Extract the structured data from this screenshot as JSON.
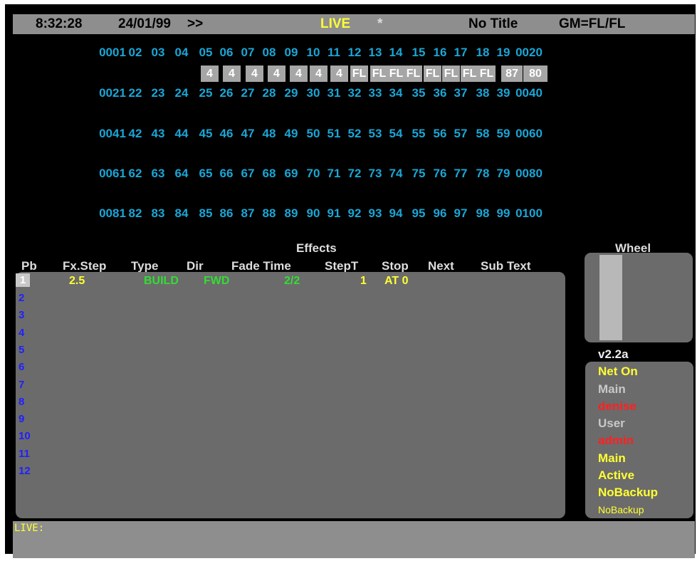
{
  "status": {
    "time": "8:32:28",
    "date": "24/01/99",
    "arrows": ">>",
    "mode": "LIVE",
    "star": "*",
    "title": "No Title",
    "gm": "GM=FL/FL"
  },
  "channels": {
    "row1": [
      "0001",
      "02",
      "03",
      "04",
      "05",
      "06",
      "07",
      "08",
      "09",
      "10",
      "11",
      "12",
      "13",
      "14",
      "15",
      "16",
      "17",
      "18",
      "19",
      "0020"
    ],
    "row2": [
      "0021",
      "22",
      "23",
      "24",
      "25",
      "26",
      "27",
      "28",
      "29",
      "30",
      "31",
      "32",
      "33",
      "34",
      "35",
      "36",
      "37",
      "38",
      "39",
      "0040"
    ],
    "row3": [
      "0041",
      "42",
      "43",
      "44",
      "45",
      "46",
      "47",
      "48",
      "49",
      "50",
      "51",
      "52",
      "53",
      "54",
      "55",
      "56",
      "57",
      "58",
      "59",
      "0060"
    ],
    "row4": [
      "0061",
      "62",
      "63",
      "64",
      "65",
      "66",
      "67",
      "68",
      "69",
      "70",
      "71",
      "72",
      "73",
      "74",
      "75",
      "76",
      "77",
      "78",
      "79",
      "0080"
    ],
    "row5": [
      "0081",
      "82",
      "83",
      "84",
      "85",
      "86",
      "87",
      "88",
      "89",
      "90",
      "91",
      "92",
      "93",
      "94",
      "95",
      "96",
      "97",
      "98",
      "99",
      "0100"
    ],
    "levels": [
      "4",
      "4",
      "4",
      "4",
      "4",
      "4",
      "4",
      "FL",
      "FL",
      "FL",
      "FL",
      "FL",
      "FL",
      "FL",
      "FL",
      "87",
      "80"
    ]
  },
  "effects": {
    "title": "Effects",
    "headers": [
      "Pb",
      "Fx.Step",
      "Type",
      "Dir",
      "Fade Time",
      "StepT",
      "Stop",
      "Next",
      "Sub Text"
    ],
    "row1": {
      "pb": "1",
      "fxstep": "2.5",
      "type": "BUILD",
      "dir": "FWD",
      "fade": "2/2",
      "stept": "1",
      "stop": "AT 0"
    },
    "playbacks": [
      "2",
      "3",
      "4",
      "5",
      "6",
      "7",
      "8",
      "9",
      "10",
      "11",
      "12"
    ]
  },
  "wheel": {
    "title": "Wheel",
    "level": 1.0
  },
  "info": {
    "version": "v2.2a",
    "net": "Net On",
    "main_label": "Main",
    "main_user": "denise",
    "user_label": "User",
    "user_name": "admin",
    "role": "Main",
    "state": "Active",
    "backup": "NoBackup",
    "backup2": "NoBackup"
  },
  "command_line": {
    "prompt": "LIVE:"
  },
  "colors": {
    "channel": "#1aa6d6",
    "live": "#ffff33",
    "playback": "#2020ff",
    "green": "#33dd33",
    "red": "#ff2020"
  }
}
